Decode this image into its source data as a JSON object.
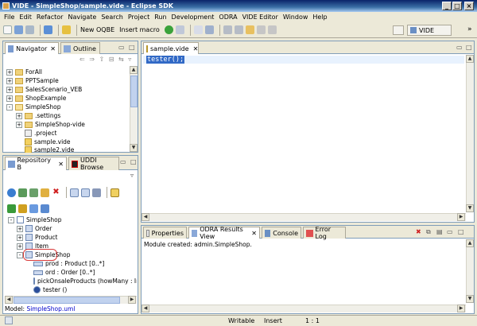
{
  "window": {
    "title": "VIDE - SimpleShop/sample.vide - Eclipse SDK"
  },
  "menu": [
    "File",
    "Edit",
    "Refactor",
    "Navigate",
    "Search",
    "Project",
    "Run",
    "Development",
    "ODRA",
    "VIDE Editor",
    "Window",
    "Help"
  ],
  "toolbar": {
    "new_oqbe": "New OQBE",
    "insert_macro": "Insert macro",
    "perspective": "VIDE",
    "more": "»"
  },
  "navigator": {
    "tab_navigator": "Navigator",
    "tab_outline": "Outline",
    "items": [
      {
        "label": "ForAll",
        "expander": "+"
      },
      {
        "label": "PPTSample",
        "expander": "+"
      },
      {
        "label": "SalesScenario_VEB",
        "expander": "+"
      },
      {
        "label": "ShopExample",
        "expander": "+"
      },
      {
        "label": "SimpleShop",
        "expander": "-"
      },
      {
        "label": ".settings",
        "expander": "+"
      },
      {
        "label": "SimpleShop-vide",
        "expander": "+"
      },
      {
        "label": ".project",
        "expander": ""
      },
      {
        "label": "sample.vide",
        "expander": ""
      },
      {
        "label": "sample2.vide",
        "expander": ""
      }
    ]
  },
  "repository": {
    "tab_repo": "Repository B",
    "tab_uddi": "UDDI Browse",
    "items": [
      {
        "label": "SimpleShop",
        "expander": "-"
      },
      {
        "label": "Order",
        "expander": "+"
      },
      {
        "label": "Product",
        "expander": "+"
      },
      {
        "label": "Item",
        "expander": "+"
      },
      {
        "label": "SimpleShop",
        "expander": "-"
      },
      {
        "label": "prod : Product [0..*]",
        "expander": ""
      },
      {
        "label": "ord : Order [0..*]",
        "expander": ""
      },
      {
        "label": "pickOnsaleProducts (howMany : Int",
        "expander": ""
      },
      {
        "label": "tester ()",
        "expander": ""
      }
    ],
    "model_label": "Model:",
    "model_link": "SimpleShop.uml"
  },
  "editor": {
    "tab": "sample.vide",
    "code": "tester();"
  },
  "bottom": {
    "tab_properties": "Properties",
    "tab_results": "ODRA Results View",
    "tab_console": "Console",
    "tab_errorlog": "Error Log",
    "output": "Module created: admin.SimpleShop."
  },
  "status": {
    "writable": "Writable",
    "insert": "Insert",
    "position": "1 : 1"
  }
}
